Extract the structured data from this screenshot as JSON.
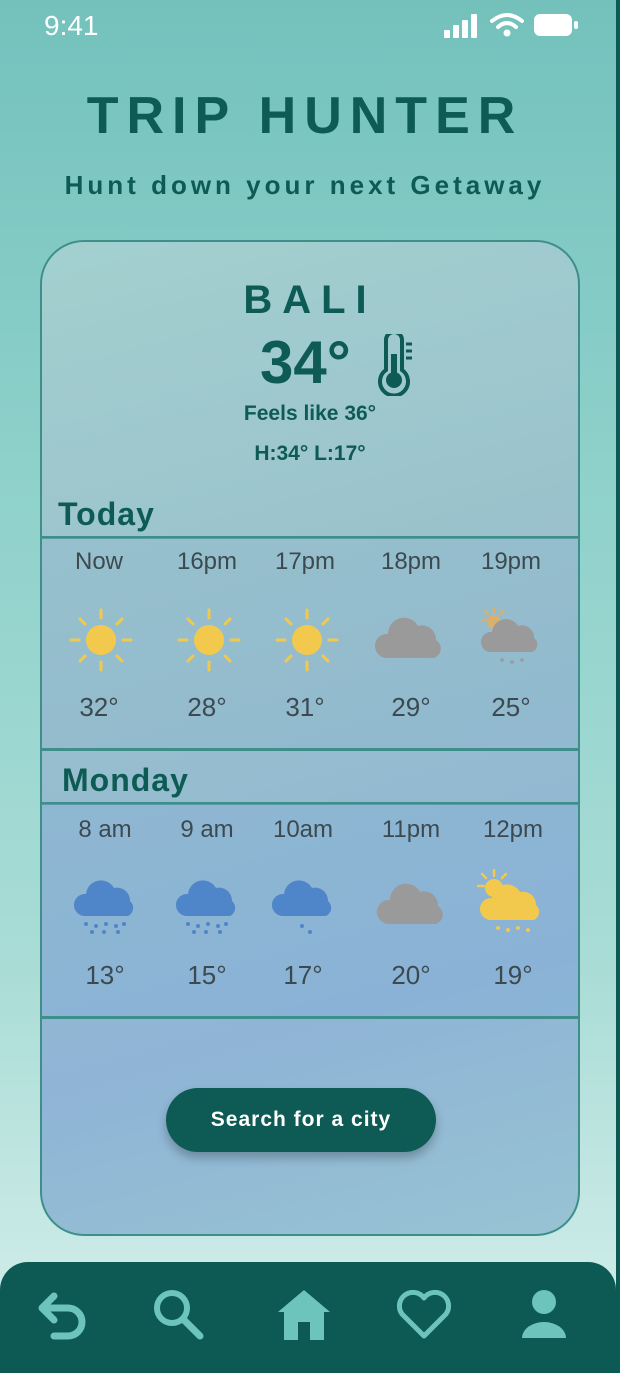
{
  "status_bar": {
    "time": "9:41"
  },
  "app": {
    "title": "TRIP HUNTER",
    "tagline": "Hunt down your next Getaway"
  },
  "weather": {
    "city": "BALI",
    "temperature": "34°",
    "feels_like": "Feels like 36°",
    "high_low": "H:34° L:17°",
    "today": {
      "label": "Today",
      "hours": [
        {
          "time": "Now",
          "icon": "sun-icon",
          "temp": "32°"
        },
        {
          "time": "16pm",
          "icon": "sun-icon",
          "temp": "28°"
        },
        {
          "time": "17pm",
          "icon": "sun-icon",
          "temp": "31°"
        },
        {
          "time": "18pm",
          "icon": "cloud-icon",
          "temp": "29°"
        },
        {
          "time": "19pm",
          "icon": "partly-cloudy-rain-icon",
          "temp": "25°"
        }
      ]
    },
    "monday": {
      "label": "Monday",
      "hours": [
        {
          "time": "8 am",
          "icon": "rain-cloud-icon",
          "temp": "13°"
        },
        {
          "time": "9 am",
          "icon": "rain-cloud-icon",
          "temp": "15°"
        },
        {
          "time": "10am",
          "icon": "light-rain-cloud-icon",
          "temp": "17°"
        },
        {
          "time": "11pm",
          "icon": "cloud-icon",
          "temp": "20°"
        },
        {
          "time": "12pm",
          "icon": "sun-behind-rain-cloud-icon",
          "temp": "19°"
        }
      ]
    }
  },
  "search_button": {
    "label": "Search for a city"
  },
  "bottom_nav": [
    {
      "name": "back",
      "icon": "back-arrow-icon"
    },
    {
      "name": "search",
      "icon": "search-icon"
    },
    {
      "name": "home",
      "icon": "home-icon"
    },
    {
      "name": "favorites",
      "icon": "heart-icon"
    },
    {
      "name": "profile",
      "icon": "user-icon"
    }
  ],
  "colors": {
    "primary": "#0d5b54",
    "nav_background": "#0c5a53",
    "icon_tint": "#6cc4bc",
    "sun": "#f2c94c",
    "cloud_gray": "#9a9a9a",
    "rain_cloud": "#4f86c9"
  }
}
